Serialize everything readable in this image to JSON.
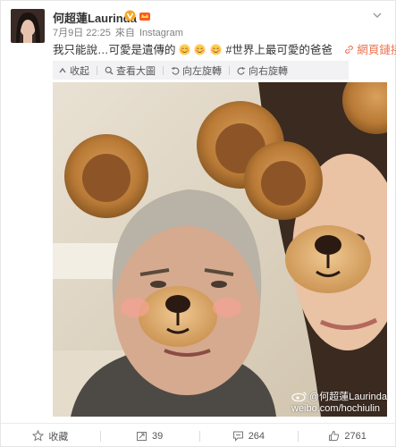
{
  "post": {
    "username": "何超蓮Laurinda",
    "verified_icon": "verified-v-icon",
    "vip_icon": "vip-crown-icon",
    "menu_icon": "chevron-down-icon",
    "date": "7月9日 22:25",
    "source_prefix": "來自",
    "source": "Instagram",
    "text": "我只能說…可愛是遺傳的",
    "topic": "#世界上最可愛的爸爸",
    "web_link": "網頁鏈接",
    "accent_color": "#eb7350"
  },
  "toolbar": {
    "collapse": "收起",
    "view_large": "查看大圖",
    "rotate_left": "向左旋轉",
    "rotate_right": "向右旋轉"
  },
  "watermark": {
    "handle": "@何超蓮Laurinda",
    "url": "weibo.com/hochiulin"
  },
  "actions": {
    "favorite": "收藏",
    "repost": "39",
    "comment": "264",
    "like": "2761"
  }
}
